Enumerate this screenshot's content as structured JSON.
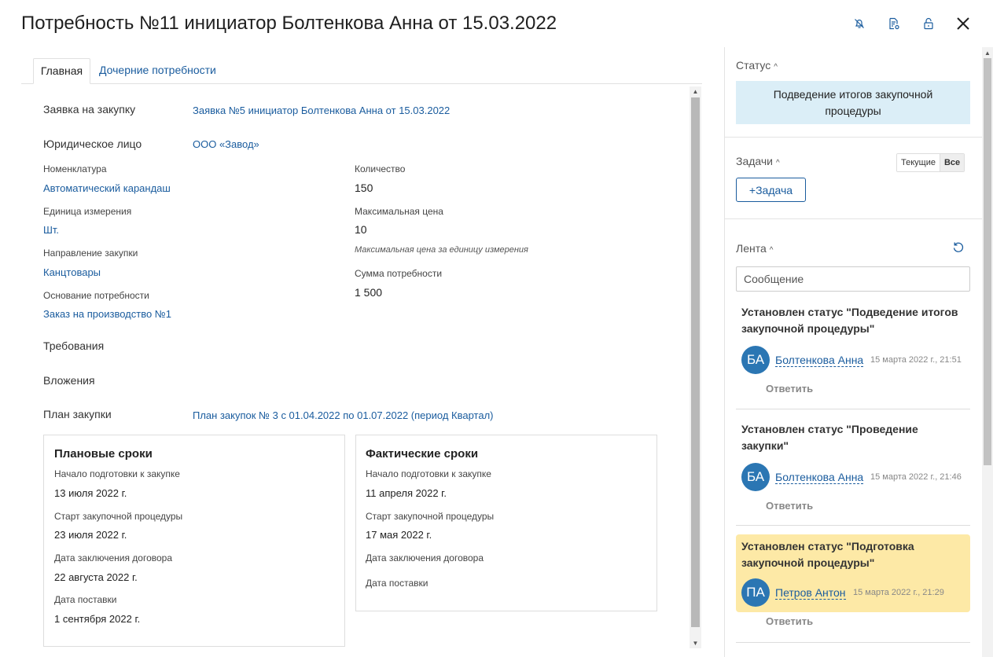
{
  "header": {
    "title": "Потребность №11 инициатор Болтенкова Анна от 15.03.2022",
    "icons": [
      "notifications-off-icon",
      "document-settings-icon",
      "lock-open-icon",
      "close-icon"
    ]
  },
  "tabs": [
    {
      "label": "Главная",
      "active": true
    },
    {
      "label": "Дочерние потребности",
      "active": false
    }
  ],
  "form": {
    "purchase_request": {
      "label": "Заявка на закупку",
      "value": "Заявка №5 инициатор Болтенкова Анна от 15.03.2022"
    },
    "legal_entity": {
      "label": "Юридическое лицо",
      "value": "ООО «Завод»"
    },
    "nomenclature": {
      "label": "Номенклатура",
      "value": "Автоматический карандаш"
    },
    "quantity": {
      "label": "Количество",
      "value": "150"
    },
    "unit": {
      "label": "Единица измерения",
      "value": "Шт."
    },
    "max_price": {
      "label": "Максимальная цена",
      "value": "10",
      "hint": "Максимальная цена за единицу измерения"
    },
    "direction": {
      "label": "Направление закупки",
      "value": "Канцтовары"
    },
    "sum": {
      "label": "Сумма потребности",
      "value": "1 500"
    },
    "basis": {
      "label": "Основание потребности",
      "value": "Заказ на производство №1"
    },
    "requirements": {
      "label": "Требования"
    },
    "attachments": {
      "label": "Вложения"
    },
    "plan": {
      "label": "План закупки",
      "value": "План закупок № 3 с 01.04.2022 по 01.07.2022 (период Квартал)"
    }
  },
  "planned": {
    "title": "Плановые сроки",
    "rows": [
      {
        "label": "Начало подготовки к закупке",
        "value": "13 июля 2022 г."
      },
      {
        "label": "Старт закупочной процедуры",
        "value": "23 июля 2022 г."
      },
      {
        "label": "Дата заключения договора",
        "value": "22 августа 2022 г."
      },
      {
        "label": "Дата поставки",
        "value": "1 сентября 2022 г."
      }
    ]
  },
  "actual": {
    "title": "Фактические сроки",
    "rows": [
      {
        "label": "Начало подготовки к закупке",
        "value": "11 апреля 2022 г."
      },
      {
        "label": "Старт закупочной процедуры",
        "value": "17 мая 2022 г."
      },
      {
        "label": "Дата заключения договора",
        "value": ""
      },
      {
        "label": "Дата поставки",
        "value": ""
      }
    ]
  },
  "sidebar": {
    "status": {
      "title": "Статус",
      "value": "Подведение итогов закупочной процедуры"
    },
    "tasks": {
      "title": "Задачи",
      "filter_current": "Текущие",
      "filter_all": "Все",
      "add_button": "+Задача"
    },
    "feed": {
      "title": "Лента",
      "input_placeholder": "Сообщение",
      "reply_label": "Ответить",
      "items": [
        {
          "text": "Установлен статус \"Подведение итогов закупочной процедуры\"",
          "initials": "БА",
          "author": "Болтенкова Анна",
          "time": "15 марта 2022 г., 21:51",
          "highlight": false
        },
        {
          "text": "Установлен статус \"Проведение закупки\"",
          "initials": "БА",
          "author": "Болтенкова Анна",
          "time": "15 марта 2022 г., 21:46",
          "highlight": false
        },
        {
          "text": "Установлен статус \"Подготовка закупочной процедуры\"",
          "initials": "ПА",
          "author": "Петров Антон",
          "time": "15 марта 2022 г., 21:29",
          "highlight": true
        }
      ]
    }
  },
  "colors": {
    "link": "#1a5c9e",
    "status_bg": "#dbeef7",
    "highlight_bg": "#fde9a6",
    "avatar_bg": "#2b76b3"
  }
}
